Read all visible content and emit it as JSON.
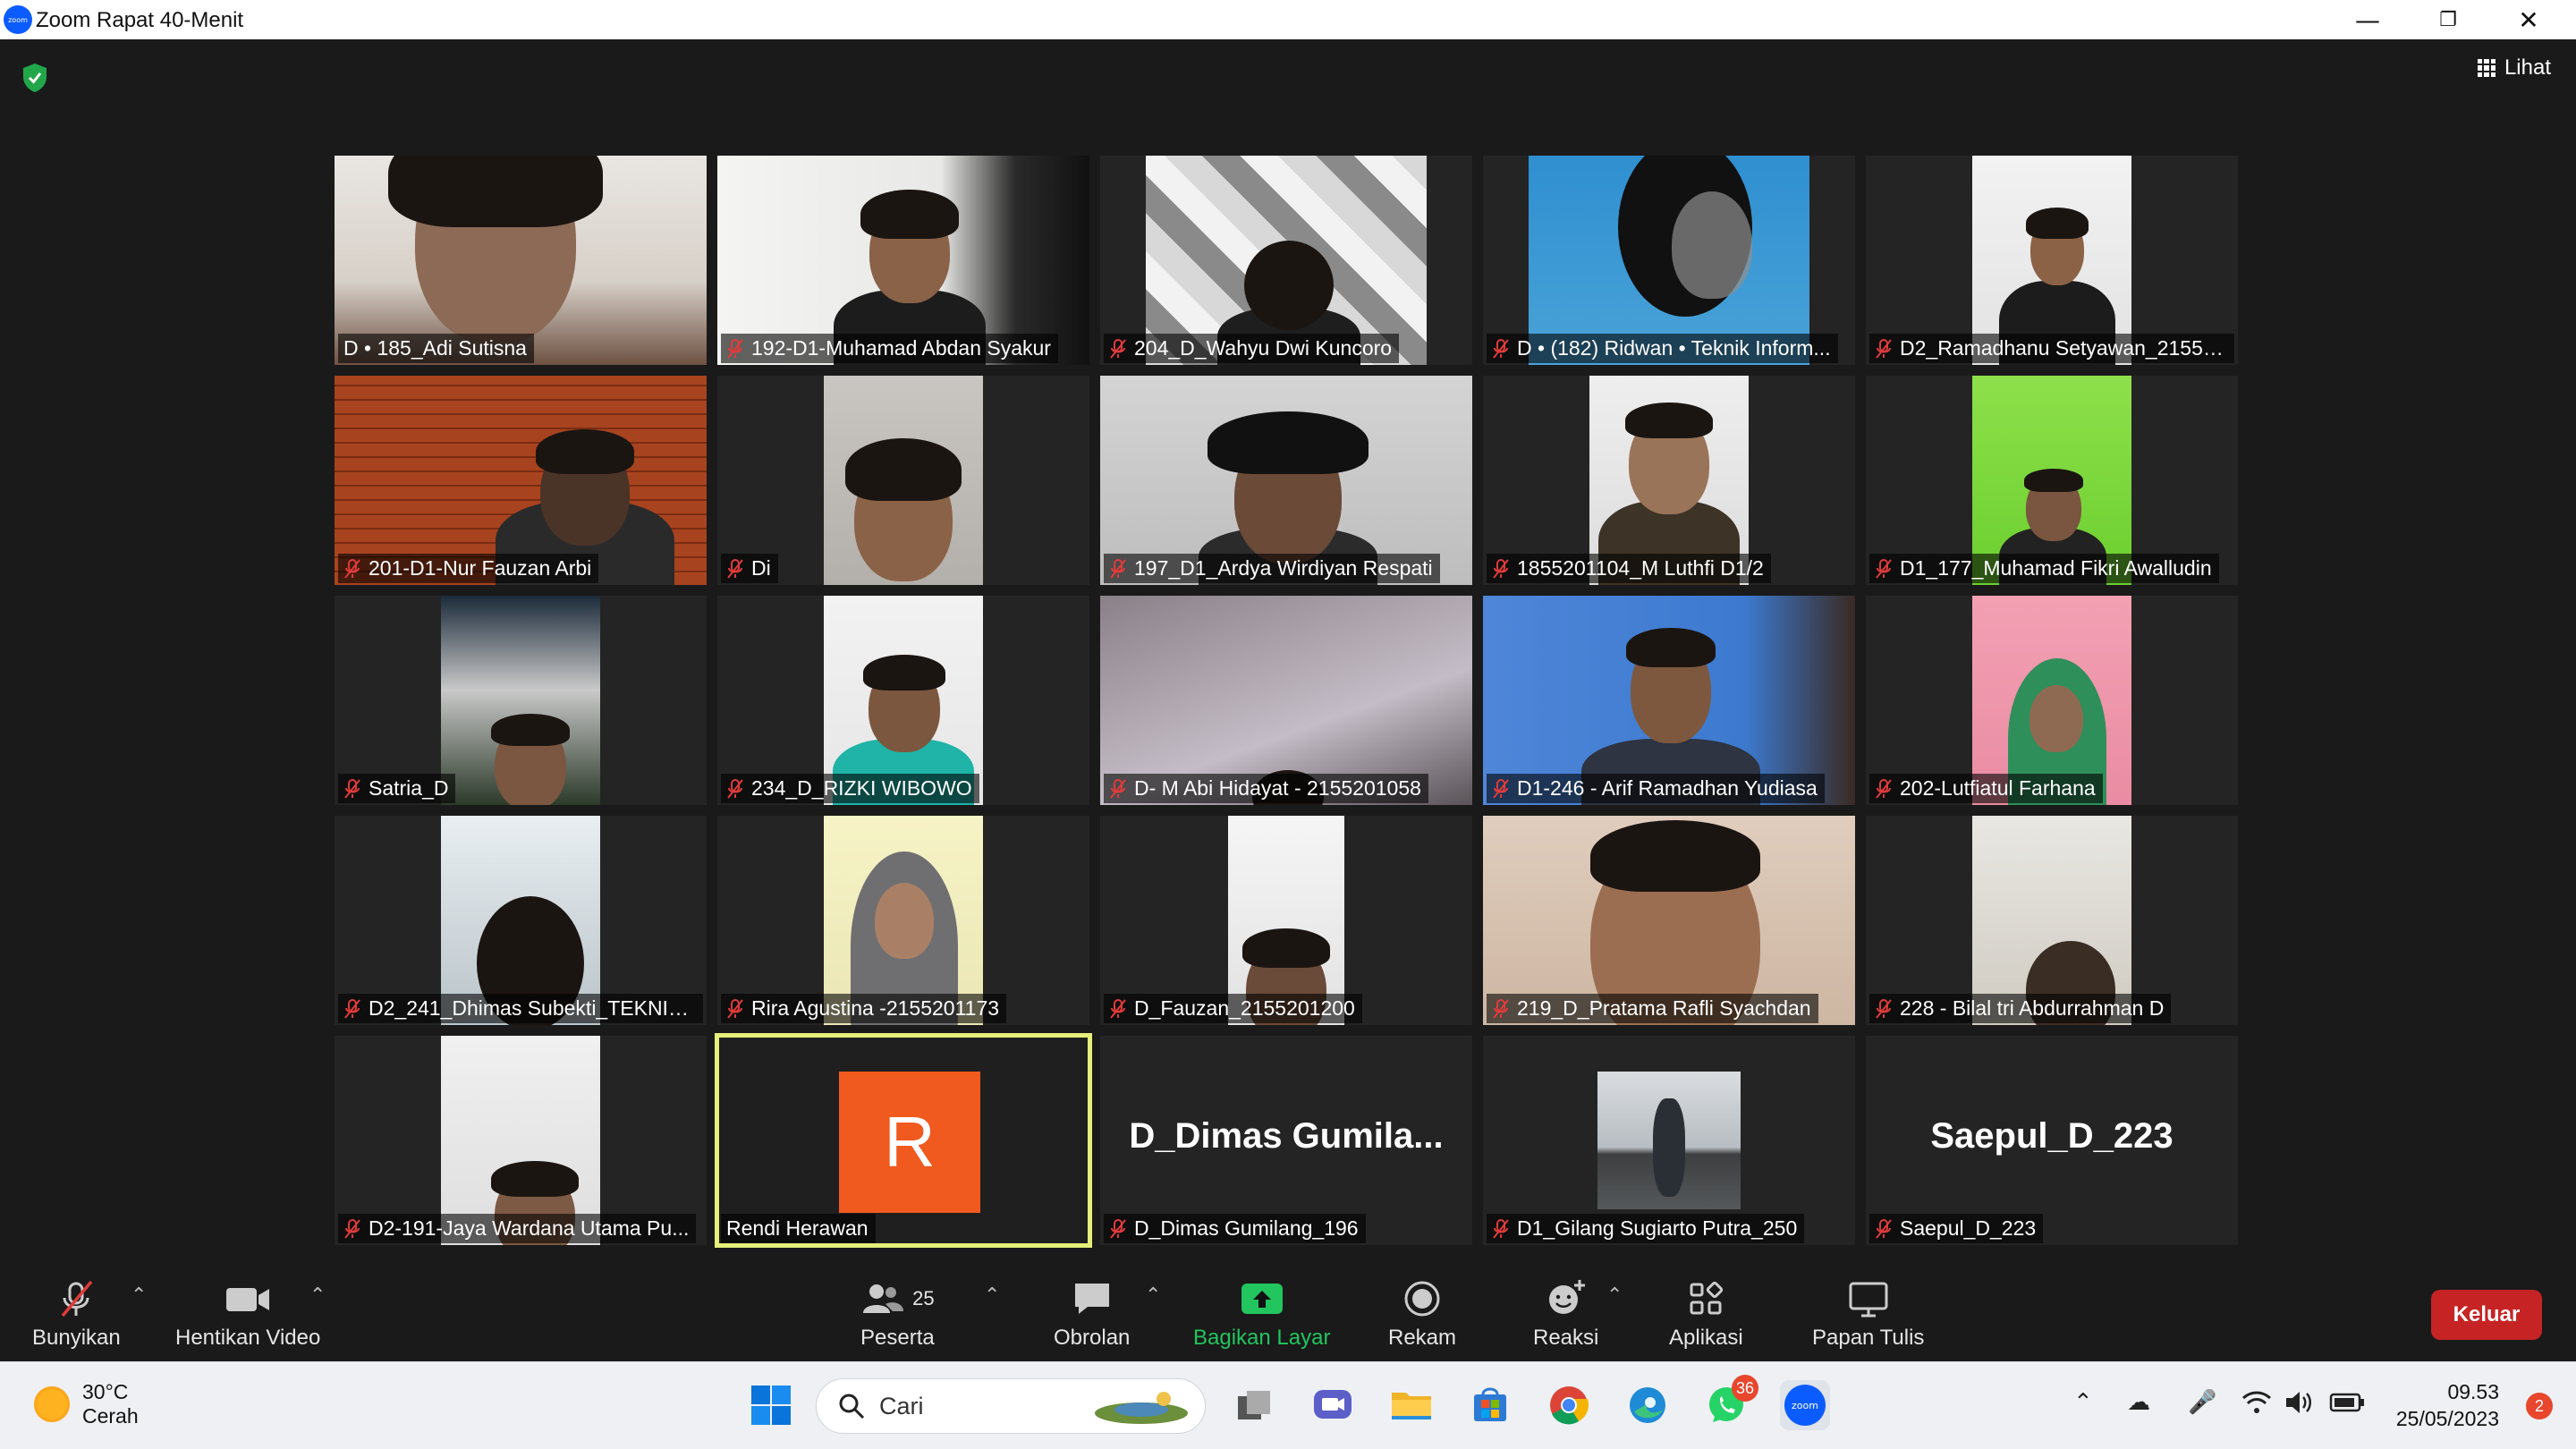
{
  "window": {
    "app_icon_text": "zoom",
    "title": "Zoom Rapat 40-Menit"
  },
  "view_button": {
    "label": "Lihat"
  },
  "participants_tiles": [
    {
      "name": "D • 185_Adi Sutisna",
      "muted": false
    },
    {
      "name": "192-D1-Muhamad Abdan Syakur",
      "muted": true
    },
    {
      "name": "204_D_Wahyu Dwi Kuncoro",
      "muted": true
    },
    {
      "name": "D • (182) Ridwan • Teknik Inform...",
      "muted": true
    },
    {
      "name": "D2_Ramadhanu Setyawan_21552...",
      "muted": true
    },
    {
      "name": "201-D1-Nur Fauzan Arbi",
      "muted": true
    },
    {
      "name": "Di",
      "muted": true
    },
    {
      "name": "197_D1_Ardya Wirdiyan Respati",
      "muted": true
    },
    {
      "name": "1855201104_M Luthfi D1/2",
      "muted": true
    },
    {
      "name": "D1_177_Muhamad Fikri Awalludin",
      "muted": true
    },
    {
      "name": "Satria_D",
      "muted": true
    },
    {
      "name": "234_D_RIZKI WIBOWO",
      "muted": true
    },
    {
      "name": "D- M Abi Hidayat - 2155201058",
      "muted": true
    },
    {
      "name": "D1-246 - Arif Ramadhan Yudiasa",
      "muted": true
    },
    {
      "name": "202-Lutfiatul Farhana",
      "muted": true
    },
    {
      "name": "D2_241_Dhimas Subekti_TEKNIK ...",
      "muted": true
    },
    {
      "name": "Rira Agustina -2155201173",
      "muted": true
    },
    {
      "name": "D_Fauzan_2155201200",
      "muted": true
    },
    {
      "name": "219_D_Pratama Rafli Syachdan",
      "muted": true
    },
    {
      "name": "228 - Bilal tri Abdurrahman D",
      "muted": true
    },
    {
      "name": "D2-191-Jaya Wardana Utama Pu...",
      "muted": true
    },
    {
      "name": "Rendi Herawan",
      "muted": false,
      "avatar_letter": "R",
      "avatar_color": "#f05a1f",
      "speaking": true
    },
    {
      "name": "D_Dimas Gumilang_196",
      "muted": true,
      "big_label": "D_Dimas  Gumila..."
    },
    {
      "name": "D1_Gilang Sugiarto Putra_250",
      "muted": true
    },
    {
      "name": "Saepul_D_223",
      "muted": true,
      "big_label": "Saepul_D_223"
    }
  ],
  "controls": {
    "mute_label": "Bunyikan",
    "video_label": "Hentikan Video",
    "participants_label": "Peserta",
    "participants_count": "25",
    "chat_label": "Obrolan",
    "share_label": "Bagikan Layar",
    "record_label": "Rekam",
    "reactions_label": "Reaksi",
    "apps_label": "Aplikasi",
    "whiteboard_label": "Papan Tulis",
    "leave_label": "Keluar"
  },
  "taskbar": {
    "weather_temp": "30°C",
    "weather_desc": "Cerah",
    "search_placeholder": "Cari",
    "whatsapp_badge": "36",
    "zoom_icon_text": "zoom",
    "time": "09.53",
    "date": "25/05/2023",
    "notification_count": "2"
  },
  "colors": {
    "background": "#1a1a1a",
    "share_green": "#22c55e",
    "leave_red": "#c62424",
    "speaker_highlight": "#e5ef7a",
    "mute_red": "#e03b3b"
  }
}
